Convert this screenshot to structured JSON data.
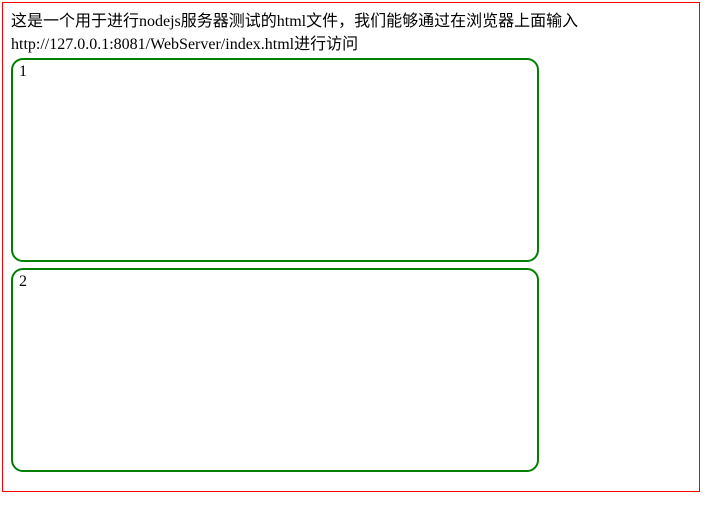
{
  "description_line1": "这是一个用于进行nodejs服务器测试的html文件，我们能够通过在浏览器上面输入",
  "description_line2": "http://127.0.0.1:8081/WebServer/index.html进行访问",
  "box1_label": "1",
  "box2_label": "2"
}
